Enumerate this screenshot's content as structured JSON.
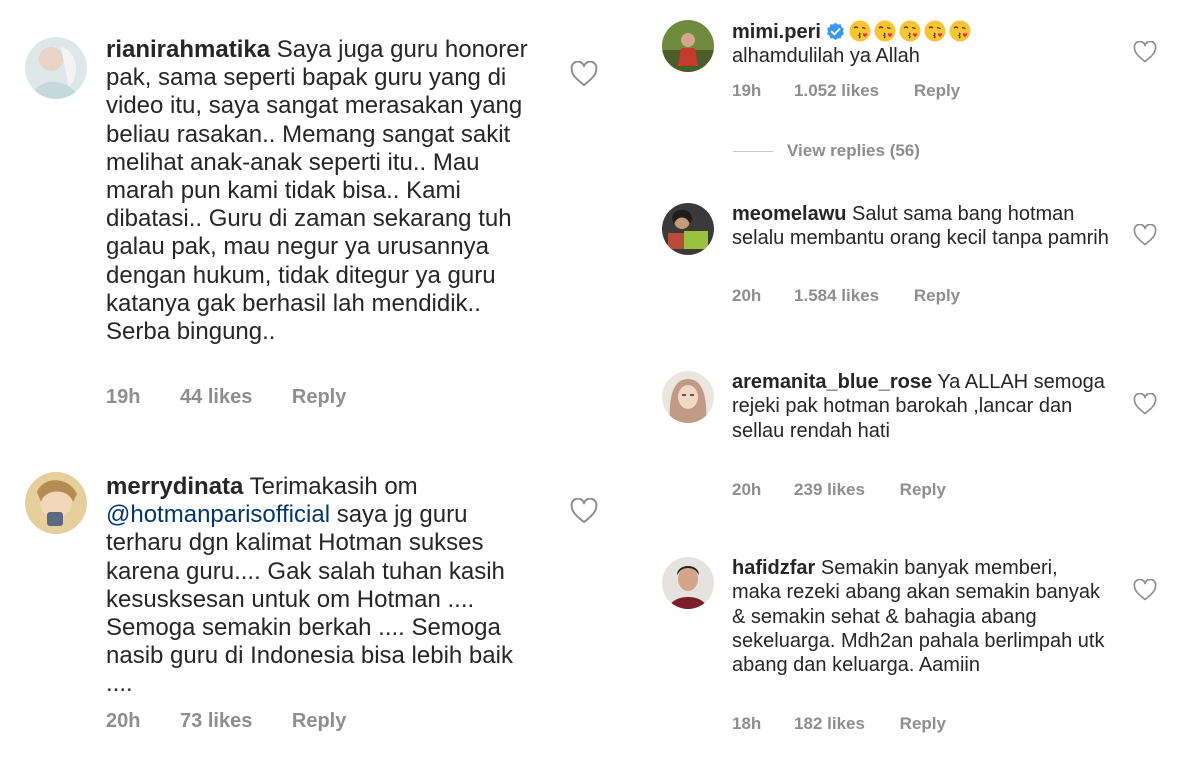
{
  "left": [
    {
      "username": "rianirahmatika",
      "text": "Saya juga guru honorer pak, sama seperti bapak guru yang di video itu, saya sangat merasakan yang beliau rasakan.. Memang sangat sakit melihat anak-anak seperti itu.. Mau marah pun kami tidak bisa.. Kami dibatasi.. Guru di zaman sekarang tuh galau pak, mau negur ya urusannya dengan hukum, tidak ditegur ya guru katanya gak berhasil lah mendidik.. Serba bingung..",
      "time": "19h",
      "likes": "44 likes",
      "reply": "Reply"
    },
    {
      "username": "merrydinata",
      "text_before": "Terimakasih om",
      "mention": "@hotmanparisofficial",
      "text_after": "saya jg guru terharu dgn kalimat Hotman sukses karena guru.... Gak salah tuhan kasih kesusksesan untuk om Hotman .... Semoga semakin berkah .... Semoga nasib guru di Indonesia bisa lebih baik ....",
      "time": "20h",
      "likes": "73 likes",
      "reply": "Reply"
    }
  ],
  "right": [
    {
      "username": "mimi.peri",
      "verified": true,
      "emoji_count": 5,
      "text": "alhamdulilah ya Allah",
      "time": "19h",
      "likes": "1.052 likes",
      "reply": "Reply",
      "view_replies": "View replies (56)"
    },
    {
      "username": "meomelawu",
      "text": "Salut sama bang hotman selalu membantu orang kecil tanpa pamrih",
      "time": "20h",
      "likes": "1.584 likes",
      "reply": "Reply"
    },
    {
      "username": "aremanita_blue_rose",
      "text": "Ya ALLAH semoga rejeki pak hotman barokah ,lancar dan sellau rendah hati",
      "time": "20h",
      "likes": "239 likes",
      "reply": "Reply"
    },
    {
      "username": "hafidzfar",
      "text": "Semakin banyak memberi, maka rezeki abang akan semakin banyak & semakin sehat & bahagia abang sekeluarga.  Mdh2an pahala berlimpah utk abang dan keluarga. Aamiin",
      "time": "18h",
      "likes": "182 likes",
      "reply": "Reply"
    }
  ],
  "colors": {
    "text": "#262626",
    "meta": "#8e8e8e",
    "mention": "#00376b",
    "verified": "#3897f0",
    "heart_stroke": "#8e8e8e"
  },
  "icons": [
    "heart-outline-icon",
    "verified-badge-icon",
    "kiss-emoji-icon"
  ]
}
